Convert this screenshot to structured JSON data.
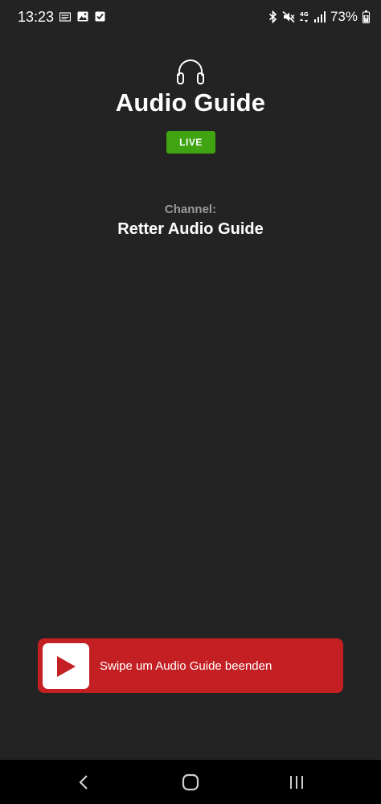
{
  "status_bar": {
    "time": "13:23",
    "battery": "73%",
    "left_icons": [
      "news-icon",
      "image-icon",
      "check-square-icon"
    ],
    "right_icons": [
      "bluetooth-icon",
      "mute-icon",
      "4g-icon",
      "signal-icon",
      "battery-icon"
    ],
    "network_label": "4G"
  },
  "header": {
    "icon": "headphones-icon",
    "title": "Audio Guide",
    "live_badge": "LIVE"
  },
  "channel": {
    "label": "Channel:",
    "name": "Retter Audio Guide"
  },
  "swipe": {
    "text": "Swipe um Audio Guide beenden",
    "handle_icon": "play-icon"
  },
  "nav": {
    "back_icon": "chevron-left-icon",
    "home_icon": "home-icon",
    "recents_icon": "recents-icon"
  },
  "colors": {
    "background": "#232324",
    "live_green": "#3fa312",
    "swipe_red": "#c42024",
    "channel_label_gray": "#9a9a9a"
  }
}
